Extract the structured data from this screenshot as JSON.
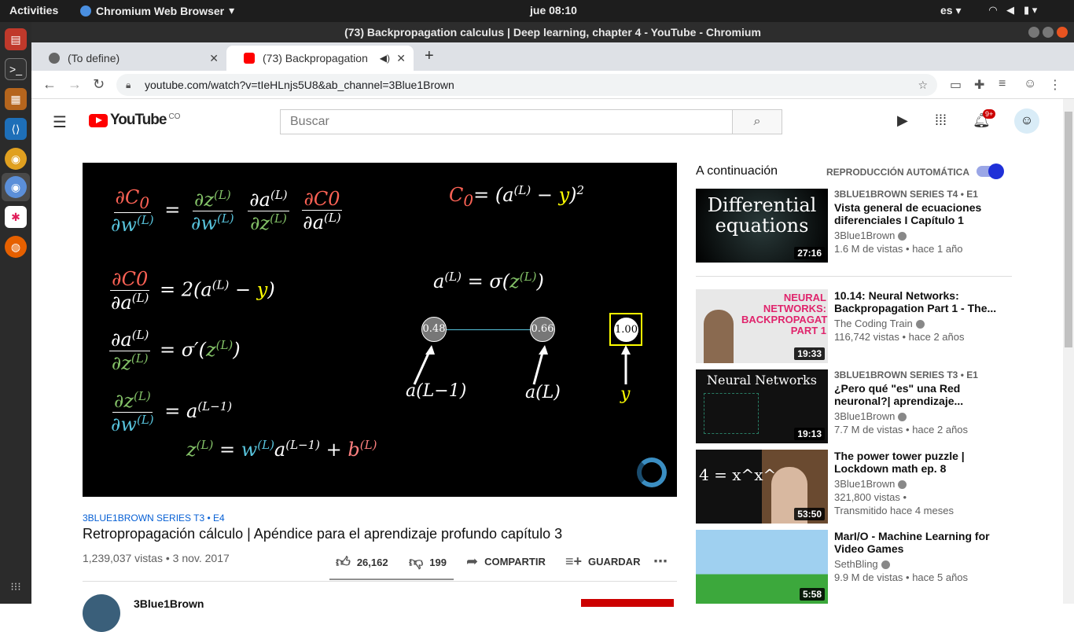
{
  "os": {
    "activities": "Activities",
    "app_name": "Chromium Web Browser",
    "clock": "jue 08:10",
    "lang": "es"
  },
  "window": {
    "title": "(73) Backpropagation calculus | Deep learning, chapter 4 - YouTube - Chromium"
  },
  "tabs": [
    {
      "label": "(To define)",
      "active": false
    },
    {
      "label": "(73) Backpropagation",
      "active": true
    }
  ],
  "address": {
    "url": "youtube.com/watch?v=tIeHLnjs5U8&ab_channel=3Blue1Brown"
  },
  "youtube": {
    "logo": "YouTube",
    "country": "CO",
    "search_placeholder": "Buscar",
    "notifications": "9+"
  },
  "video": {
    "eq_cost": "C₀= (a",
    "eq_cost_tail": " − y)²",
    "eq_act": "a",
    "node_left": "0.48",
    "node_mid": "0.66",
    "node_y": "1.00",
    "label_left": "a(L−1)",
    "label_mid": "a(L)",
    "label_y": "y"
  },
  "meta": {
    "series": "3BLUE1BROWN SERIES  T3 • E4",
    "title": "Retropropagación cálculo | Apéndice para el aprendizaje profundo capítulo 3",
    "views_date": "1,239,037 vistas • 3 nov. 2017",
    "likes": "26,162",
    "dislikes": "199",
    "share": "COMPARTIR",
    "save": "GUARDAR",
    "channel": "3Blue1Brown"
  },
  "sidebar": {
    "up_next": "A continuación",
    "autoplay": "REPRODUCCIÓN AUTOMÁTICA",
    "items": [
      {
        "series": "3BLUE1BROWN SERIES  T4 • E1",
        "title": "Vista general de ecuaciones diferenciales I Capítulo 1",
        "channel": "3Blue1Brown",
        "views": "1.6 M de vistas • hace 1 año",
        "duration": "27:16",
        "thumb_text": "Differential equations"
      },
      {
        "series": "",
        "title": "10.14: Neural Networks: Backpropagation Part 1 - The...",
        "channel": "The Coding Train",
        "views": "116,742 vistas • hace 2 años",
        "duration": "19:33",
        "thumb_text": "NEURAL NETWORKS: BACKPROPAGATION PART 1"
      },
      {
        "series": "3BLUE1BROWN SERIES  T3 • E1",
        "title": "¿Pero qué \"es\" una Red neuronal?| aprendizaje...",
        "channel": "3Blue1Brown",
        "views": "7.7 M de vistas • hace 2 años",
        "duration": "19:13",
        "thumb_text": "Neural Networks"
      },
      {
        "series": "",
        "title": "The power tower puzzle | Lockdown math ep. 8",
        "channel": "3Blue1Brown",
        "views": "321,800 vistas •",
        "views2": "Transmitido hace 4 meses",
        "duration": "53:50",
        "thumb_text": "4 = x^x^x"
      },
      {
        "series": "",
        "title": "MarI/O - Machine Learning for Video Games",
        "channel": "SethBling",
        "views": "9.9 M de vistas • hace 5 años",
        "duration": "5:58",
        "thumb_text": ""
      }
    ]
  }
}
